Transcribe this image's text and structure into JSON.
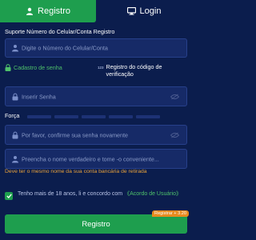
{
  "tabs": {
    "register_label": "Registro",
    "login_label": "Login"
  },
  "phone": {
    "label": "Suporte Número do Celular/Conta Registro",
    "placeholder": "Digite o Número do Celular/Conta"
  },
  "options": {
    "password_reg_label": "Cadastro de senha",
    "code_reg_label_line1": "Registro do código de",
    "code_reg_label_line2": "verificação"
  },
  "password": {
    "placeholder": "Inserir Senha"
  },
  "strength": {
    "label": "Força"
  },
  "confirm": {
    "placeholder": "Por favor, confirme sua senha novamente"
  },
  "realname": {
    "placeholder": "Preencha o nome verdadeiro e tome -o conveniente..."
  },
  "warning": "Deve ter o mesmo nome da sua conta bancária de retirada",
  "agreement": {
    "text": "Tenho mais de 18 anos, li e concordo com ",
    "link": "《Acordo de Usuário》"
  },
  "submit": {
    "label": "Registro",
    "badge": "Registrar + 3.20"
  },
  "colors": {
    "background": "#0b1d4d",
    "accent": "#1e9e4e",
    "warning": "#e8a13a",
    "badge": "#e88a1f"
  }
}
